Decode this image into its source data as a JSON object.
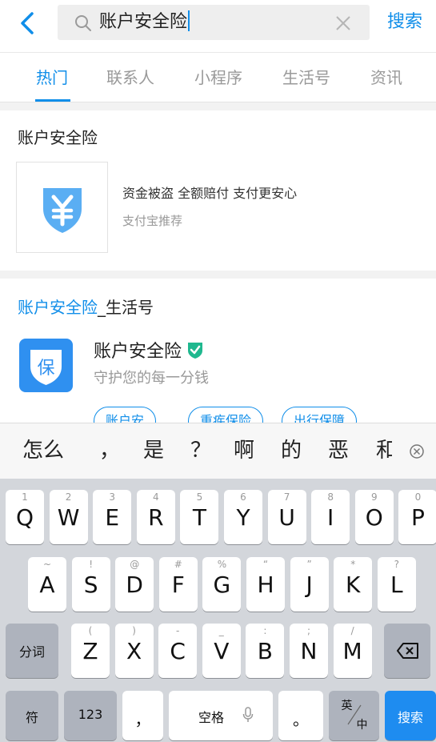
{
  "search": {
    "query": "账户安全险",
    "submit_label": "搜索"
  },
  "tabs": [
    {
      "label": "热门"
    },
    {
      "label": "联系人"
    },
    {
      "label": "小程序"
    },
    {
      "label": "生活号"
    },
    {
      "label": "资讯"
    }
  ],
  "product": {
    "title": "账户安全险",
    "description": "资金被盗 全额赔付 支付更安心",
    "source": "支付宝推荐",
    "icon": "yuan-shield-icon"
  },
  "life_account": {
    "section_title_highlight": "账户安全险",
    "section_title_suffix": "_生活号",
    "name": "账户安全险",
    "slogan": "守护您的每一分钱",
    "icon_char": "保",
    "chips": [
      "账户安",
      "重疾保险",
      "出行保障"
    ]
  },
  "candidates": [
    "怎么",
    "，",
    "是",
    "？",
    "啊",
    "的",
    "恶",
    "和"
  ],
  "keyboard": {
    "row1": [
      {
        "hint": "1",
        "key": "Q"
      },
      {
        "hint": "2",
        "key": "W"
      },
      {
        "hint": "3",
        "key": "E"
      },
      {
        "hint": "4",
        "key": "R"
      },
      {
        "hint": "5",
        "key": "T"
      },
      {
        "hint": "6",
        "key": "Y"
      },
      {
        "hint": "7",
        "key": "U"
      },
      {
        "hint": "8",
        "key": "I"
      },
      {
        "hint": "9",
        "key": "O"
      },
      {
        "hint": "0",
        "key": "P"
      }
    ],
    "row2": [
      {
        "hint": "~",
        "key": "A"
      },
      {
        "hint": "!",
        "key": "S"
      },
      {
        "hint": "@",
        "key": "D"
      },
      {
        "hint": "#",
        "key": "F"
      },
      {
        "hint": "%",
        "key": "G"
      },
      {
        "hint": "“",
        "key": "H"
      },
      {
        "hint": "”",
        "key": "J"
      },
      {
        "hint": "*",
        "key": "K"
      },
      {
        "hint": "?",
        "key": "L"
      }
    ],
    "row3": [
      {
        "hint": "(",
        "key": "Z"
      },
      {
        "hint": ")",
        "key": "X"
      },
      {
        "hint": "-",
        "key": "C"
      },
      {
        "hint": "_",
        "key": "V"
      },
      {
        "hint": ":",
        "key": "B"
      },
      {
        "hint": ";",
        "key": "N"
      },
      {
        "hint": "/",
        "key": "M"
      }
    ],
    "fenci": "分词",
    "fu": "符",
    "num": "123",
    "comma": "，",
    "space": "空格",
    "period": "。",
    "lang_top": "英",
    "lang_bottom": "中",
    "search": "搜索"
  },
  "colors": {
    "accent": "#108ee9",
    "key_dark": "#aeb3bd",
    "keyboard_bg": "#d3d6db",
    "verify_green": "#1fb88f"
  }
}
